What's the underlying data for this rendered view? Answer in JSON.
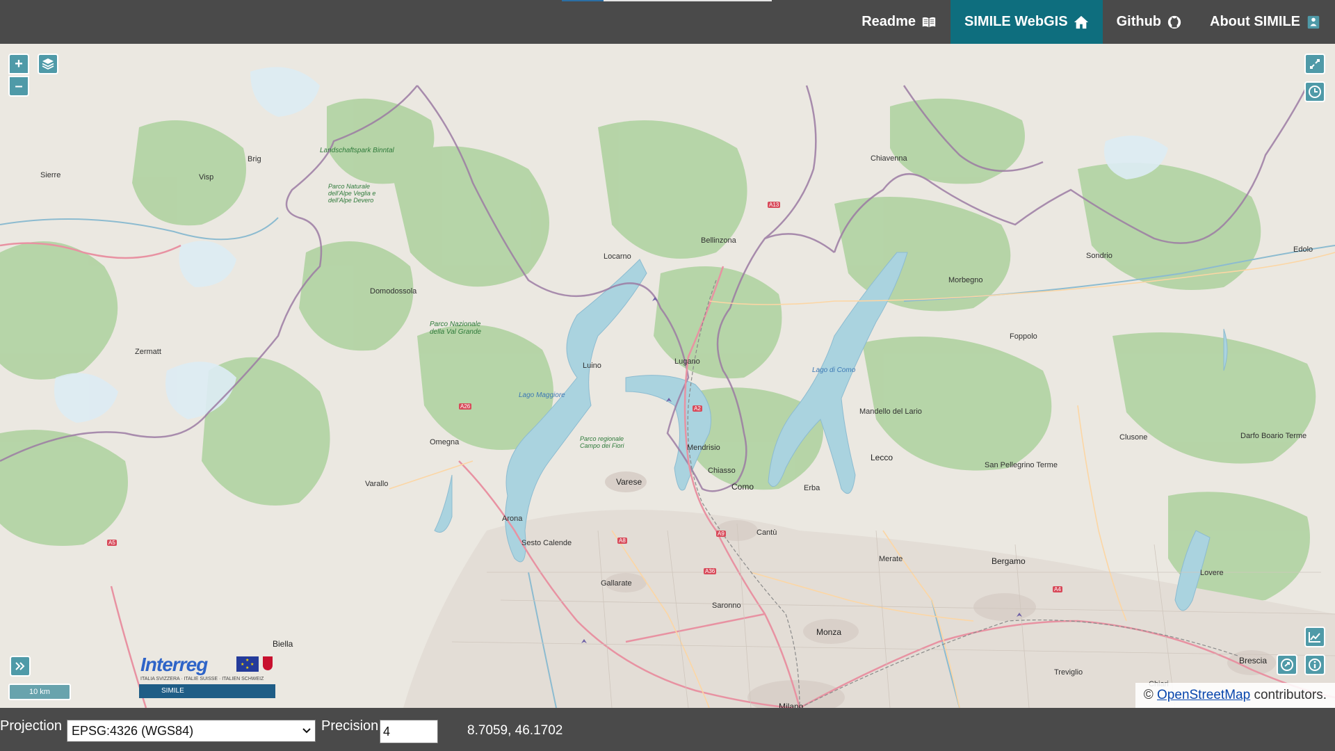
{
  "nav": {
    "items": [
      {
        "label": "Readme",
        "icon": "book-icon",
        "active": false
      },
      {
        "label": "SIMILE WebGIS",
        "icon": "home-icon",
        "active": true
      },
      {
        "label": "Github",
        "icon": "github-icon",
        "active": false
      },
      {
        "label": "About SIMILE",
        "icon": "info-person-icon",
        "active": false
      }
    ]
  },
  "map": {
    "controls": {
      "zoom_in": "+",
      "zoom_out": "–",
      "layers_icon": "layers-icon",
      "fullscreen_icon": "fullscreen-icon",
      "history_icon": "clock-icon",
      "chart_icon": "chart-icon",
      "share_icon": "share-icon",
      "info_icon": "info-icon",
      "expand_icon": "double-chevron-right-icon"
    },
    "scale": "10 km",
    "attribution_prefix": "©",
    "attribution_link": "OpenStreetMap",
    "attribution_suffix": "contributors.",
    "labels": {
      "sion": "Sierre",
      "visp": "Visp",
      "brig": "Brig",
      "zermatt": "Zermatt",
      "domodossola": "Domodossola",
      "locarno": "Locarno",
      "bellinzona": "Bellinzona",
      "lugano": "Lugano",
      "luino": "Luino",
      "mendrisio": "Mendrisio",
      "chiasso": "Chiasso",
      "como": "Como",
      "varese": "Varese",
      "lecco": "Lecco",
      "bergamo": "Bergamo",
      "monza": "Monza",
      "milano": "Milano",
      "brescia": "Brescia",
      "chiavenna": "Chiavenna",
      "sondrio": "Sondrio",
      "morbegno": "Morbegno",
      "biella": "Biella",
      "varallo": "Varallo",
      "omegna": "Omegna",
      "arona": "Arona",
      "sesto": "Sesto Calende",
      "gallarate": "Gallarate",
      "saronno": "Saronno",
      "erba": "Erba",
      "cantu": "Cantù",
      "menaggio": "Mandello del Lario",
      "merate": "Merate",
      "clusone": "Clusone",
      "sanpellegrino": "San Pellegrino Terme",
      "treviglio": "Treviglio",
      "chiari": "Chiari",
      "darfo": "Darfo Boario Terme",
      "lovere": "Lovere",
      "foppolo": "Foppolo",
      "edolo": "Edolo",
      "binntal": "Landschaftspark Binntal",
      "devero": "Parco Naturale dell'Alpe Veglia e dell'Alpe Devero",
      "valgrande": "Parco Nazionale della Val Grande",
      "campodeifiori": "Parco regionale Campo dei Fiori",
      "maggiore": "Lago Maggiore",
      "lariovalle": "Lago di Como",
      "a13": "A13",
      "a2": "A2",
      "a26": "A26",
      "a5": "A5",
      "a8": "A8",
      "a9": "A9",
      "a36": "A36",
      "a4": "A4"
    },
    "logo": {
      "word": "Interreg",
      "tagline": "ITALIA SVIZZERA · ITALIE SUISSE · ITALIEN SCHWEIZ",
      "project": "SIMILE"
    }
  },
  "footer": {
    "projection_label": "Projection",
    "projection_value": "EPSG:4326 (WGS84)",
    "precision_label": "Precision",
    "precision_value": "4",
    "coordinates": "8.7059, 46.1702"
  },
  "colors": {
    "navbar": "#4a4a4a",
    "active_tab": "#0e6e7e",
    "control": "#4f9aa8",
    "forest": "#add19e",
    "water": "#aad3df",
    "urban": "#d9d0c9",
    "motorway": "#e892a2"
  }
}
